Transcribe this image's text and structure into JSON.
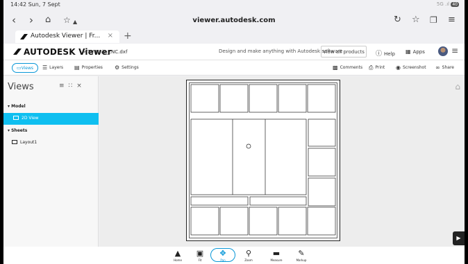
{
  "status": {
    "time": "14:42  Sun, 7 Sept",
    "right": "5G .ıl",
    "battery": "40"
  },
  "browser": {
    "url": "viewer.autodesk.com",
    "tab_title": "Autodesk Viewer | Fr...",
    "tab_close": "×",
    "new_tab": "+"
  },
  "app": {
    "logo": "AUTODESK Viewer",
    "file_crumb": "> TV Unit_CNC.dxf",
    "tagline": "Design and make anything with Autodesk software",
    "view_all": "View all products",
    "help": "Help",
    "apps": "Apps"
  },
  "toolbar": {
    "views": "Views",
    "layers": "Layers",
    "properties": "Properties",
    "settings": "Settings",
    "comments": "Comments",
    "print": "Print",
    "screenshot": "Screenshot",
    "share": "Share"
  },
  "panel": {
    "title": "Views",
    "model": "Model",
    "view_2d": "2D View",
    "sheets": "Sheets",
    "layout": "Layout1"
  },
  "bottom": {
    "home": "Home",
    "fit": "Fit",
    "pan": "Pan",
    "zoom": "Zoom",
    "measure": "Measure",
    "markup": "Markup"
  },
  "colors": {
    "accent": "#0696d7",
    "selected": "#0fbff0"
  }
}
